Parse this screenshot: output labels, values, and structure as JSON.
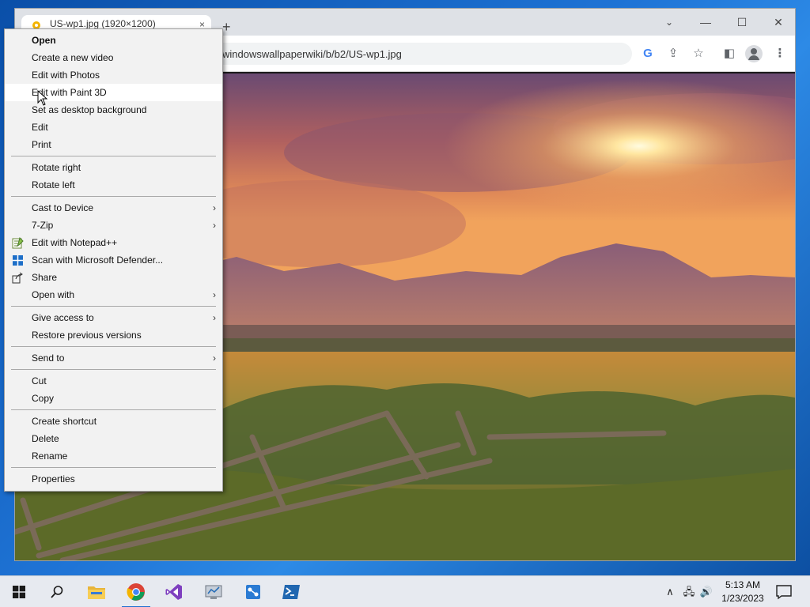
{
  "browser": {
    "tab_title": "US-wp1.jpg (1920×1200)",
    "tab_close": "×",
    "new_tab": "+",
    "tab_search": "⌄",
    "minimize": "—",
    "maximize": "☐",
    "close": "✕",
    "url": "windowswallpaperwiki/b/b2/US-wp1.jpg",
    "google_glyph": "G",
    "share_glyph": "⇪",
    "star_glyph": "☆",
    "sidepanel_glyph": "◧",
    "menu_glyph": "⋮"
  },
  "context_menu": {
    "groups": [
      [
        {
          "label": "Open",
          "bold": true
        },
        {
          "label": "Create a new video"
        },
        {
          "label": "Edit with Photos"
        },
        {
          "label": "Edit with Paint 3D",
          "hover": true
        },
        {
          "label": "Set as desktop background"
        },
        {
          "label": "Edit"
        },
        {
          "label": "Print"
        }
      ],
      [
        {
          "label": "Rotate right"
        },
        {
          "label": "Rotate left"
        }
      ],
      [
        {
          "label": "Cast to Device",
          "submenu": true
        },
        {
          "label": "7-Zip",
          "submenu": true
        },
        {
          "label": "Edit with Notepad++",
          "icon": "notepad-plus-plus-icon"
        },
        {
          "label": "Scan with Microsoft Defender...",
          "icon": "defender-shield-icon"
        },
        {
          "label": "Share",
          "icon": "share-icon"
        },
        {
          "label": "Open with",
          "submenu": true
        }
      ],
      [
        {
          "label": "Give access to",
          "submenu": true
        },
        {
          "label": "Restore previous versions"
        }
      ],
      [
        {
          "label": "Send to",
          "submenu": true
        }
      ],
      [
        {
          "label": "Cut"
        },
        {
          "label": "Copy"
        }
      ],
      [
        {
          "label": "Create shortcut"
        },
        {
          "label": "Delete"
        },
        {
          "label": "Rename"
        }
      ],
      [
        {
          "label": "Properties"
        }
      ]
    ],
    "submenu_glyph": "›"
  },
  "taskbar": {
    "apps": [
      "start-button",
      "search-button",
      "file-explorer",
      "chrome",
      "visual-studio",
      "server-manager",
      "network-tool",
      "powershell"
    ],
    "active_app": "chrome",
    "tray": {
      "chevron": "∧",
      "network_glyph": "🖧",
      "volume_glyph": "🔊"
    },
    "time": "5:13 AM",
    "date": "1/23/2023"
  },
  "colors": {
    "menu_bg": "#f2f2f2",
    "menu_hover": "#ffffff",
    "taskbar_bg": "#e7eaf0",
    "accent": "#1f6fd1"
  }
}
